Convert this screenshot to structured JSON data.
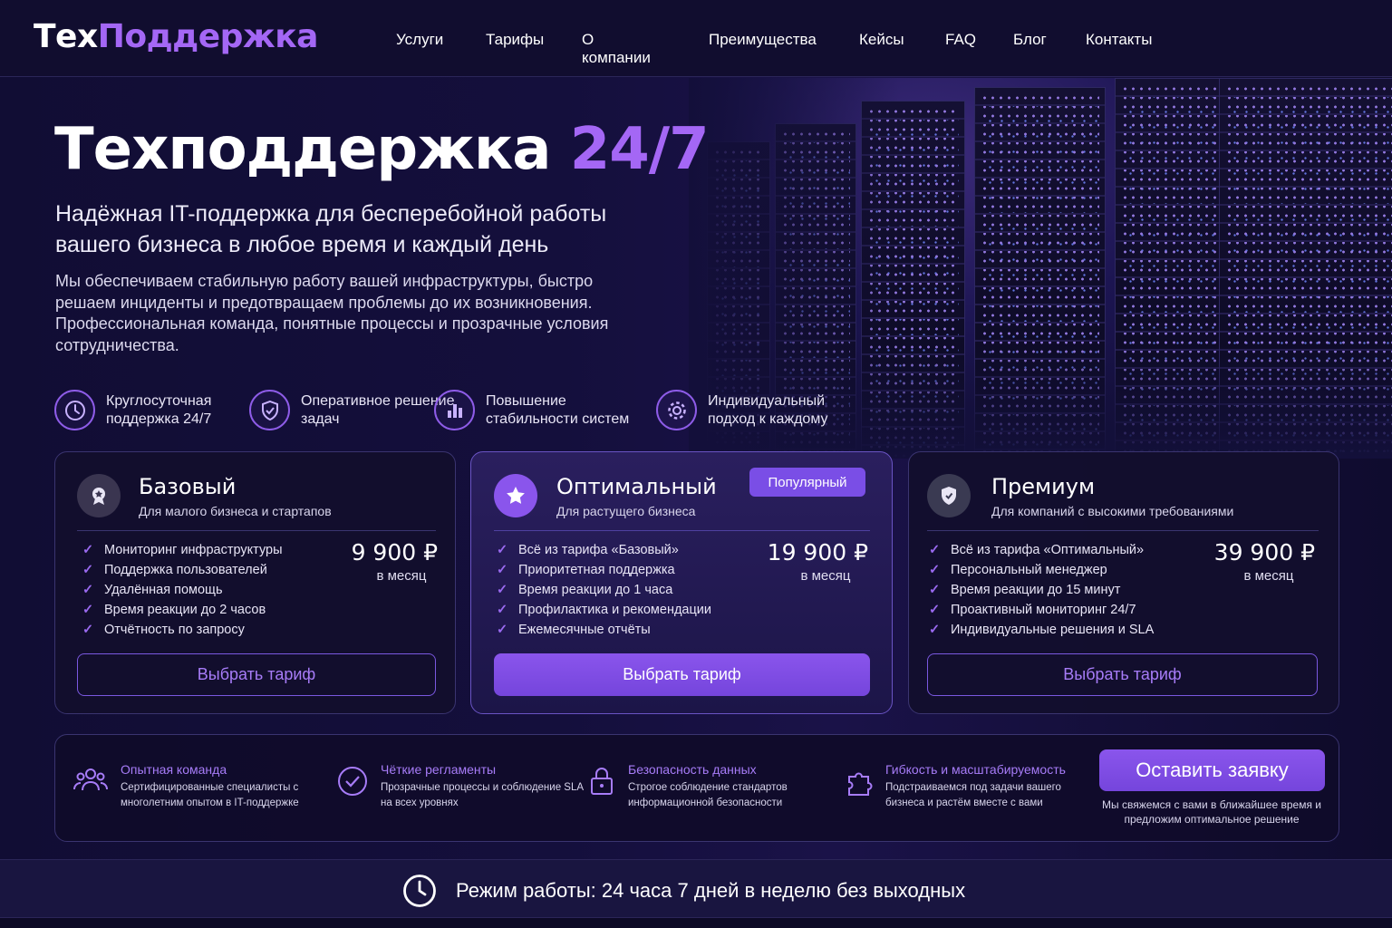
{
  "header": {
    "logo_part1": "Тех",
    "logo_part2": "Поддержка",
    "nav": [
      "Услуги",
      "Тарифы",
      "О компании",
      "Преимущества",
      "Кейсы",
      "FAQ",
      "Блог",
      "Контакты"
    ]
  },
  "hero": {
    "title_main": "Техподдержка",
    "title_highlight": "24/7",
    "subtitle": "Надёжная IT-поддержка для бесперебойной работы вашего бизнеса в любое время и каждый день",
    "description": "Мы обеспечиваем стабильную работу вашей инфраструктуры, быстро решаем инциденты и предотвращаем проблемы до их возникновения. Профессиональная команда, понятные процессы и прозрачные условия сотрудничества.",
    "features": [
      {
        "icon": "clock-icon",
        "text": "Круглосуточная поддержка 24/7"
      },
      {
        "icon": "shield-check-icon",
        "text": "Оперативное решение задач"
      },
      {
        "icon": "bar-chart-icon",
        "text": "Повышение стабильности систем"
      },
      {
        "icon": "gear-icon",
        "text": "Индивидуальный подход к каждому"
      }
    ]
  },
  "plans": [
    {
      "name": "Базовый",
      "for": "Для малого бизнеса и стартапов",
      "icon": "award-icon",
      "items": [
        "Мониторинг инфраструктуры",
        "Поддержка пользователей",
        "Удалённая помощь",
        "Время реакции до 2 часов",
        "Отчётность по запросу"
      ],
      "price": "9 900 ₽",
      "period": "в месяц",
      "button": "Выбрать тариф"
    },
    {
      "name": "Оптимальный",
      "for": "Для растущего бизнеса",
      "icon": "star-icon",
      "badge": "Популярный",
      "items": [
        "Всё из тарифа «Базовый»",
        "Приоритетная поддержка",
        "Время реакции до 1 часа",
        "Профилактика и рекомендации",
        "Ежемесячные отчёты"
      ],
      "price": "19 900 ₽",
      "period": "в месяц",
      "button": "Выбрать тариф"
    },
    {
      "name": "Премиум",
      "for": "Для компаний с высокими требованиями",
      "icon": "shield-icon",
      "items": [
        "Всё из тарифа «Оптимальный»",
        "Персональный менеджер",
        "Время реакции до 15 минут",
        "Проактивный мониторинг 24/7",
        "Индивидуальные решения и SLA"
      ],
      "price": "39 900 ₽",
      "period": "в месяц",
      "button": "Выбрать тариф"
    }
  ],
  "benefits": [
    {
      "icon": "team-icon",
      "title": "Опытная команда",
      "text": "Сертифицированные специалисты с многолетним опытом в IT-поддержке"
    },
    {
      "icon": "check-circle-icon",
      "title": "Чёткие регламенты",
      "text": "Прозрачные процессы и соблюдение SLA на всех уровнях"
    },
    {
      "icon": "lock-icon",
      "title": "Безопасность данных",
      "text": "Строгое соблюдение стандартов информационной безопасности"
    },
    {
      "icon": "puzzle-icon",
      "title": "Гибкость и масштабируемость",
      "text": "Подстраиваемся под задачи вашего бизнеса и растём вместе с вами"
    }
  ],
  "cta": {
    "button": "Оставить заявку",
    "note": "Мы свяжемся с вами в ближайшее время и предложим оптимальное решение"
  },
  "footer": {
    "hours_icon": "clock-icon",
    "hours": "Режим работы: 24 часа 7 дней в неделю без выходных"
  },
  "colors": {
    "accent": "#a467f5",
    "background": "#110d34",
    "button": "#7a4ee6"
  }
}
